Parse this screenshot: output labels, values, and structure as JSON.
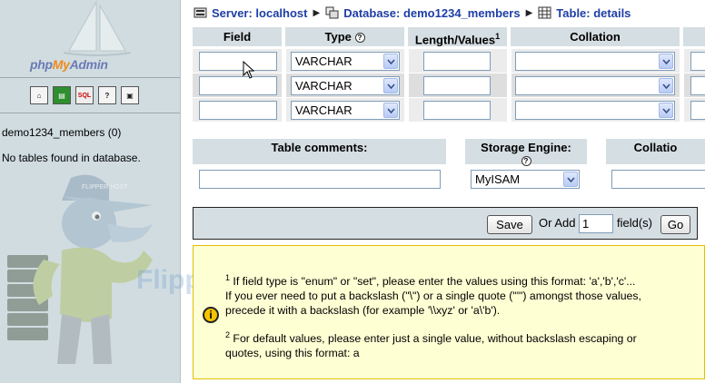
{
  "sidebar": {
    "logo_php": "php",
    "logo_my": "My",
    "logo_admin": "Admin",
    "icons": [
      {
        "name": "home-icon",
        "glyph": "⌂"
      },
      {
        "name": "query-window-icon",
        "glyph": "▤"
      },
      {
        "name": "sql-icon",
        "glyph": "SQL"
      },
      {
        "name": "documentation-icon",
        "glyph": "?"
      },
      {
        "name": "phpinfo-icon",
        "glyph": "▣"
      }
    ],
    "db_name": "demo1234_members (0)",
    "no_tables": "No tables found in database."
  },
  "breadcrumb": {
    "server": "Server: localhost",
    "database": "Database: demo1234_members",
    "table": "Table: details"
  },
  "fields_table": {
    "headers": {
      "field": "Field",
      "type": "Type",
      "length": "Length/Values",
      "length_sup": "1",
      "collation": "Collation"
    },
    "rows": [
      {
        "field": "",
        "type": "VARCHAR",
        "length": "",
        "collation": ""
      },
      {
        "field": "",
        "type": "VARCHAR",
        "length": "",
        "collation": ""
      },
      {
        "field": "",
        "type": "VARCHAR",
        "length": "",
        "collation": ""
      }
    ]
  },
  "table_options": {
    "comments_label": "Table comments:",
    "comments_value": "",
    "engine_label": "Storage Engine:",
    "engine_value": "MyISAM",
    "collation_label": "Collatio"
  },
  "save_bar": {
    "save_label": "Save",
    "or_add": "Or Add",
    "add_count": "1",
    "fields_label": "field(s)",
    "go_label": "Go"
  },
  "notes": {
    "note1_sup": "1",
    "note1_line1": " If field type is \"enum\" or \"set\", please enter the values using this format: 'a','b','c'...",
    "note1_line2": "If you ever need to put a backslash (\"\\\") or a single quote (\"'\") amongst those values,",
    "note1_line3": "precede it with a backslash (for example '\\\\xyz' or 'a\\'b').",
    "note2_sup": "2",
    "note2_line1": " For default values, please enter just a single value, without backslash escaping or",
    "note2_line2": "quotes, using this format: a"
  },
  "watermark": {
    "brand": "FlipperHost",
    "mascot_cap": "FLIPPER HOST"
  },
  "colors": {
    "sidebar_bg": "#d0dce0",
    "header_bg": "#d5dee3",
    "link_blue": "#1e3ea6",
    "notes_bg": "#ffffd4",
    "notes_border": "#e0c200"
  }
}
